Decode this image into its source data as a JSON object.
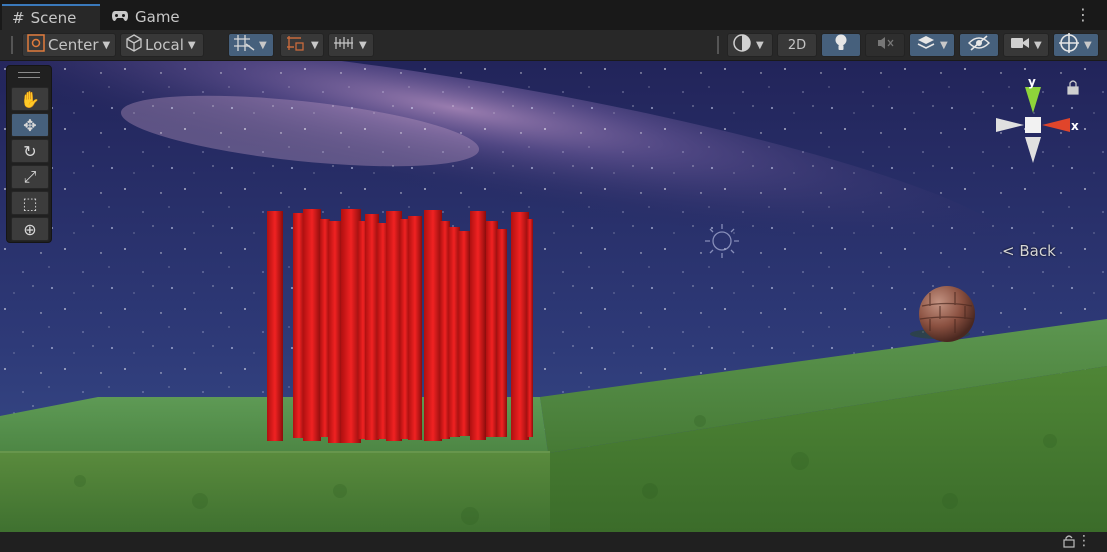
{
  "tabs": [
    {
      "label": "Scene",
      "icon": "hash-icon",
      "active": true
    },
    {
      "label": "Game",
      "icon": "gamepad-icon",
      "active": false
    }
  ],
  "toolbar": {
    "pivot_mode": "Center",
    "pivot_rotation": "Local",
    "view_2d_label": "2D"
  },
  "tools": [
    {
      "name": "hand-tool",
      "icon": "hand-icon",
      "glyph": "✋",
      "selected": false
    },
    {
      "name": "move-tool",
      "icon": "move-icon",
      "glyph": "✥",
      "selected": true
    },
    {
      "name": "rotate-tool",
      "icon": "rotate-icon",
      "glyph": "↻",
      "selected": false
    },
    {
      "name": "scale-tool",
      "icon": "scale-icon",
      "glyph": "⤢",
      "selected": false
    },
    {
      "name": "rect-tool",
      "icon": "rect-icon",
      "glyph": "⬚",
      "selected": false
    },
    {
      "name": "transform-tool",
      "icon": "transform-icon",
      "glyph": "⊕",
      "selected": false
    }
  ],
  "gizmo": {
    "y_label": "y",
    "x_label": "x",
    "view_label": "Back"
  },
  "colors": {
    "accent": "#46607c",
    "tab_highlight": "#3a79bb",
    "pillar_red": "#e01818",
    "grass": "#4f8a3a",
    "axis_x": "#e0452b",
    "axis_y": "#8ed43a"
  }
}
